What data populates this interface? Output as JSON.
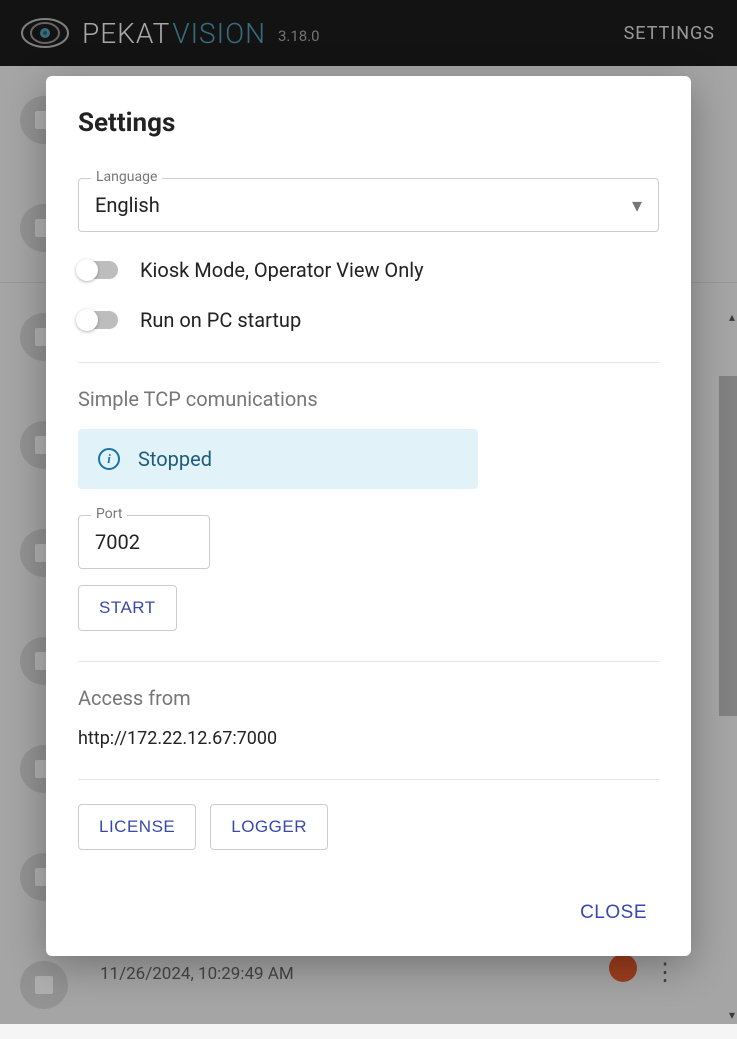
{
  "header": {
    "brand_1": "PEKAT",
    "brand_2": "VISION",
    "version": "3.18.0",
    "settings_link": "SETTINGS"
  },
  "background": {
    "timestamp": "11/26/2024, 10:29:49 AM"
  },
  "modal": {
    "title": "Settings",
    "language": {
      "label": "Language",
      "value": "English"
    },
    "toggles": {
      "kiosk_label": "Kiosk Mode, Operator View Only",
      "startup_label": "Run on PC startup"
    },
    "tcp": {
      "heading": "Simple TCP comunications",
      "status": "Stopped",
      "port_label": "Port",
      "port_value": "7002",
      "start_button": "START"
    },
    "access": {
      "heading": "Access from",
      "url": "http://172.22.12.67:7000"
    },
    "buttons": {
      "license": "LICENSE",
      "logger": "LOGGER",
      "close": "CLOSE"
    }
  }
}
